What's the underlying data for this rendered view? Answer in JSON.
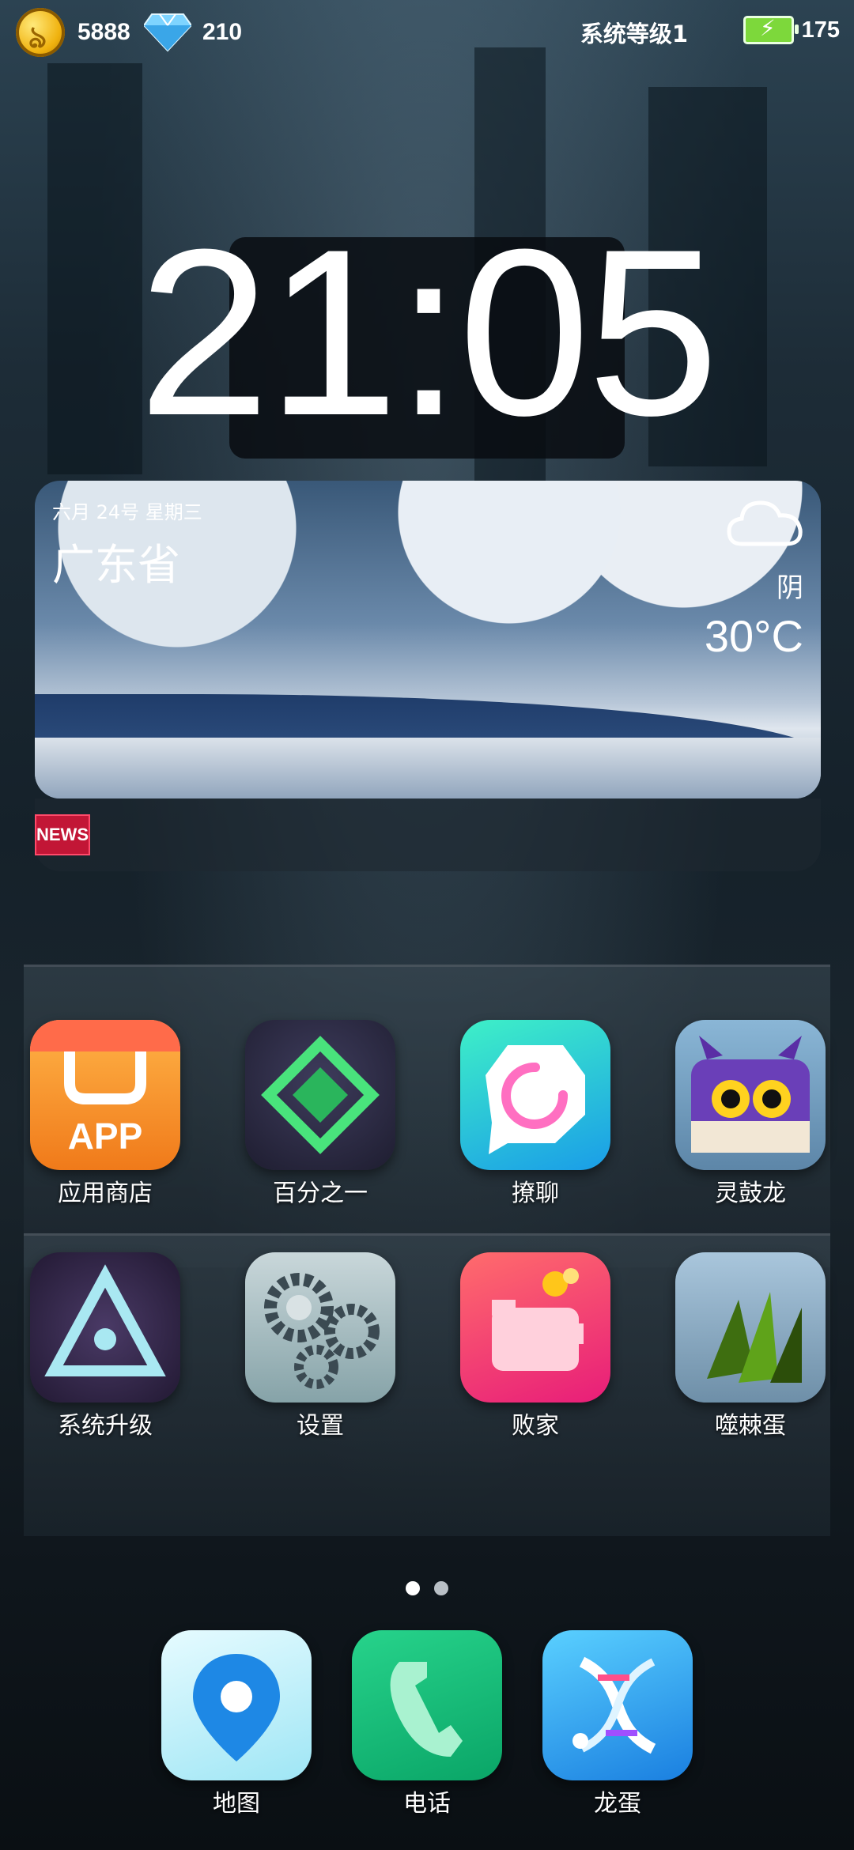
{
  "status": {
    "coins": "5888",
    "gems": "210",
    "level": "系统等级1",
    "battery": "175"
  },
  "clock": {
    "time": "21:05"
  },
  "weather": {
    "date": "六月 24号 星期三",
    "city": "广东省",
    "condition": "阴",
    "temperature": "30°C"
  },
  "news": {
    "badge": "NEWS"
  },
  "apps": [
    {
      "label": "应用商店",
      "icon": "app-store-icon"
    },
    {
      "label": "百分之一",
      "icon": "percent-one-icon"
    },
    {
      "label": "撩聊",
      "icon": "chat-icon"
    },
    {
      "label": "灵鼓龙",
      "icon": "dragon-icon"
    },
    {
      "label": "系统升级",
      "icon": "system-upgrade-icon"
    },
    {
      "label": "设置",
      "icon": "settings-gear-icon"
    },
    {
      "label": "败家",
      "icon": "piggy-bank-icon"
    },
    {
      "label": "噬棘蛋",
      "icon": "claw-egg-icon"
    }
  ],
  "app_store_text": "APP",
  "dock": [
    {
      "label": "地图",
      "icon": "map-pin-icon"
    },
    {
      "label": "电话",
      "icon": "phone-icon"
    },
    {
      "label": "龙蛋",
      "icon": "dna-icon"
    }
  ],
  "page_indicator": {
    "pages": 2,
    "current": 1
  }
}
